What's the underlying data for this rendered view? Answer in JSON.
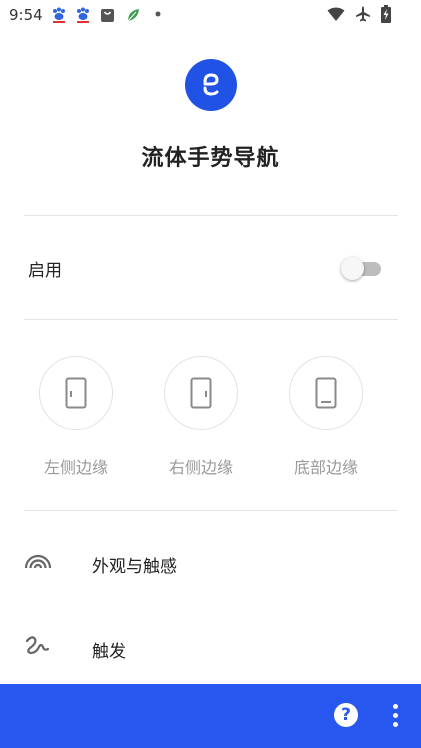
{
  "status_bar": {
    "time": "9:54",
    "left_icons": [
      "baidu-paw-icon",
      "baidu-paw-icon",
      "shopping-bag-icon",
      "leaf-icon",
      "dot-icon"
    ],
    "right_icons": [
      "wifi-icon",
      "airplane-icon",
      "battery-charging-icon"
    ]
  },
  "header": {
    "app_title": "流体手势导航",
    "logo_icon": "fluid-logo-icon",
    "logo_color": "#2152e6"
  },
  "enable": {
    "label": "启用",
    "switch_on": false
  },
  "edges": [
    {
      "label": "左侧边缘",
      "icon": "door-left-icon"
    },
    {
      "label": "右侧边缘",
      "icon": "door-right-icon"
    },
    {
      "label": "底部边缘",
      "icon": "phone-bottom-icon"
    }
  ],
  "menu": [
    {
      "label": "外观与触感",
      "icon": "rainbow-icon"
    },
    {
      "label": "触发",
      "icon": "squiggle-icon"
    }
  ],
  "bottom_bar": {
    "color": "#2857f0",
    "help_label": "?",
    "help_icon": "help-icon",
    "more_icon": "more-vert-icon"
  }
}
